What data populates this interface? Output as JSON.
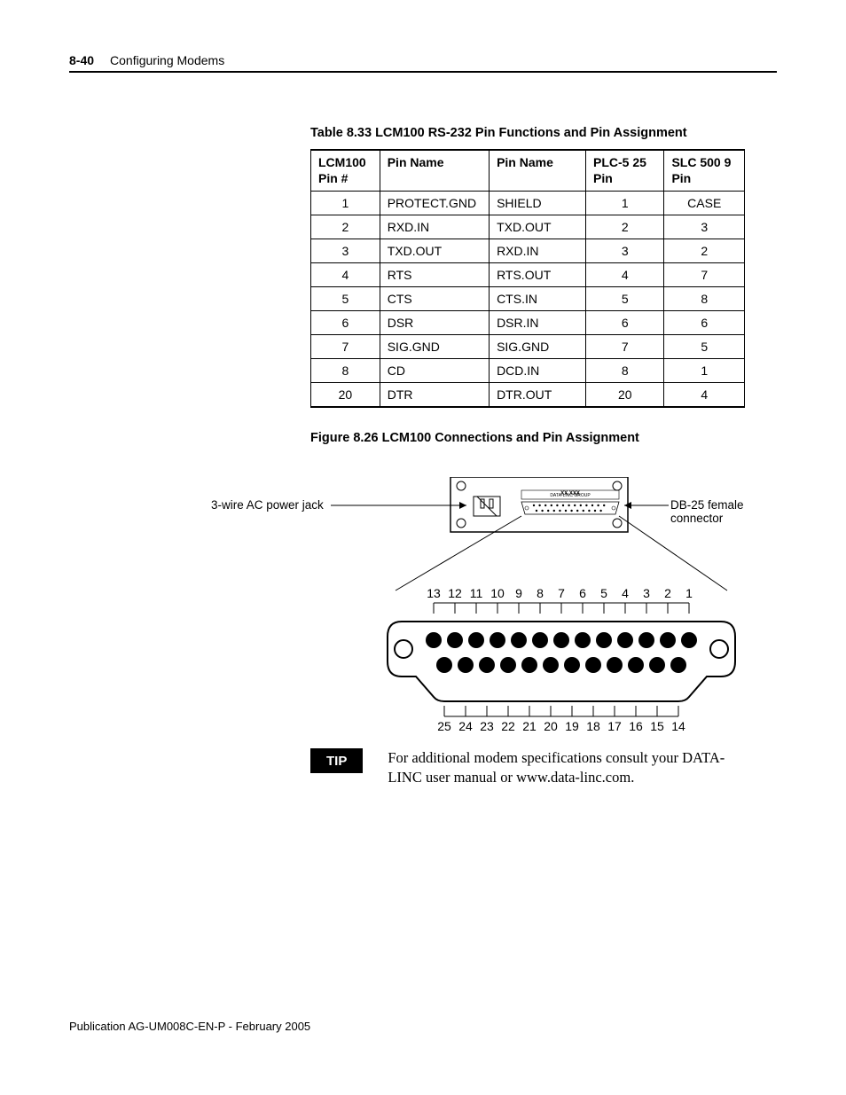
{
  "header": {
    "page_number": "8-40",
    "section_title": "Configuring Modems"
  },
  "table": {
    "caption": "Table 8.33 LCM100 RS-232 Pin Functions and Pin Assignment",
    "headers": {
      "c0": "LCM100 Pin #",
      "c1": "Pin Name",
      "c2": "Pin Name",
      "c3": "PLC-5 25 Pin",
      "c4": "SLC 500 9 Pin"
    },
    "rows": [
      {
        "c0": "1",
        "c1": "PROTECT.GND",
        "c2": "SHIELD",
        "c3": "1",
        "c4": "CASE"
      },
      {
        "c0": "2",
        "c1": "RXD.IN",
        "c2": "TXD.OUT",
        "c3": "2",
        "c4": "3"
      },
      {
        "c0": "3",
        "c1": "TXD.OUT",
        "c2": "RXD.IN",
        "c3": "3",
        "c4": "2"
      },
      {
        "c0": "4",
        "c1": "RTS",
        "c2": "RTS.OUT",
        "c3": "4",
        "c4": "7"
      },
      {
        "c0": "5",
        "c1": "CTS",
        "c2": "CTS.IN",
        "c3": "5",
        "c4": "8"
      },
      {
        "c0": "6",
        "c1": "DSR",
        "c2": "DSR.IN",
        "c3": "6",
        "c4": "6"
      },
      {
        "c0": "7",
        "c1": "SIG.GND",
        "c2": "SIG.GND",
        "c3": "7",
        "c4": "5"
      },
      {
        "c0": "8",
        "c1": "CD",
        "c2": "DCD.IN",
        "c3": "8",
        "c4": "1"
      },
      {
        "c0": "20",
        "c1": "DTR",
        "c2": "DTR.OUT",
        "c3": "20",
        "c4": "4"
      }
    ]
  },
  "figure": {
    "caption": "Figure 8.26 LCM100 Connections and Pin Assignment",
    "callout_left": "3-wire AC power jack",
    "callout_right": "DB-25 female connector",
    "device_label_1": "DATA-LINC GROUP",
    "device_label_2": "XX XXX",
    "pins_top": [
      "13",
      "12",
      "11",
      "10",
      "9",
      "8",
      "7",
      "6",
      "5",
      "4",
      "3",
      "2",
      "1"
    ],
    "pins_bottom": [
      "25",
      "24",
      "23",
      "22",
      "21",
      "20",
      "19",
      "18",
      "17",
      "16",
      "15",
      "14"
    ]
  },
  "tip": {
    "badge": "TIP",
    "text": "For additional modem specifications consult your DATA-LINC user manual or www.data-linc.com."
  },
  "footer": {
    "publication": "Publication AG-UM008C-EN-P - February 2005"
  }
}
